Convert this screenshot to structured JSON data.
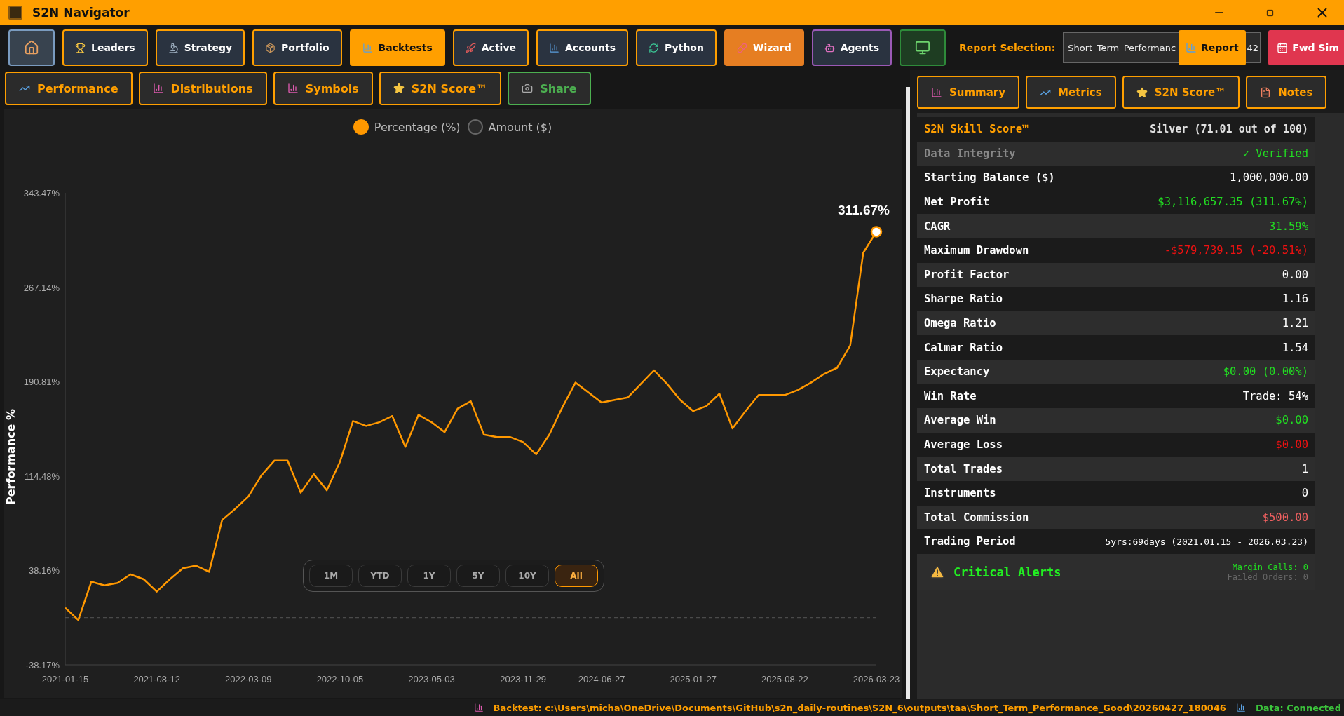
{
  "window": {
    "title": "S2N Navigator"
  },
  "nav": [
    {
      "kind": "icon",
      "selected": false,
      "color": "#7a9bbf"
    },
    {
      "kind": "outline",
      "label": "Leaders",
      "selected": false,
      "color": "#ff9f00"
    },
    {
      "kind": "outline",
      "label": "Strategy",
      "selected": false,
      "color": "#ff9f00"
    },
    {
      "kind": "outline",
      "label": "Portfolio",
      "selected": false,
      "color": "#ff9f00"
    },
    {
      "kind": "outline",
      "label": "Backtests",
      "selected": true,
      "color": "#ff9f00"
    },
    {
      "kind": "outline",
      "label": "Active",
      "selected": false,
      "color": "#ff9f00"
    },
    {
      "kind": "outline",
      "label": "Accounts",
      "selected": false,
      "color": "#ff9f00"
    },
    {
      "kind": "outline",
      "label": "Python",
      "selected": false,
      "color": "#ff9f00"
    },
    {
      "kind": "filled",
      "label": "Wizard",
      "selected": false,
      "color": "#e67e22"
    },
    {
      "kind": "outline",
      "label": "Agents",
      "selected": false,
      "color": "#9b59b6"
    },
    {
      "kind": "icon",
      "selected": false,
      "color": "#2e8b3a"
    }
  ],
  "report": {
    "label": "Report Selection:",
    "value": "Short_Term_Performanc",
    "value_tail": "42",
    "report_button": "Report",
    "fwd_sim_button": "Fwd Sim"
  },
  "chart_tabs": [
    {
      "label": "Performance",
      "color": "#ff9f00"
    },
    {
      "label": "Distributions",
      "color": "#ff9f00"
    },
    {
      "label": "Symbols",
      "color": "#ff9f00"
    },
    {
      "label": "S2N Score™",
      "color": "#ff9f00"
    },
    {
      "label": "Share",
      "color": "#4caf50"
    }
  ],
  "mode_options": [
    {
      "label": "Percentage (%)",
      "selected": true
    },
    {
      "label": "Amount ($)",
      "selected": false
    }
  ],
  "chart_data": {
    "type": "line",
    "ylabel": "Performance %",
    "categories": [
      "2021-01-15",
      null,
      null,
      null,
      null,
      null,
      null,
      "2021-08-12",
      null,
      null,
      null,
      null,
      null,
      null,
      "2022-03-09",
      null,
      null,
      null,
      null,
      null,
      null,
      "2022-10-05",
      null,
      null,
      null,
      null,
      null,
      null,
      "2023-05-03",
      null,
      null,
      null,
      null,
      null,
      null,
      "2023-11-29",
      null,
      null,
      null,
      null,
      null,
      "2024-06-27",
      null,
      null,
      null,
      null,
      null,
      null,
      "2025-01-27",
      null,
      null,
      null,
      null,
      null,
      null,
      "2025-08-22",
      null,
      null,
      null,
      null,
      null,
      null,
      "2026-03-23"
    ],
    "series": [
      {
        "color": "#ff9800",
        "values": [
          8,
          -2,
          29,
          26,
          28,
          35,
          31,
          21,
          31,
          40,
          42,
          37,
          79,
          88,
          98,
          115,
          127,
          127,
          101,
          116,
          103,
          126,
          159,
          155,
          158,
          163,
          138,
          164,
          158,
          150,
          169,
          175,
          148,
          146,
          146,
          142,
          132,
          148,
          170,
          190,
          182,
          174,
          176,
          178,
          189,
          200,
          189,
          176,
          167,
          171,
          181,
          153,
          167,
          180,
          180,
          180,
          184,
          190,
          197,
          202,
          220,
          295,
          312
        ]
      }
    ],
    "ylim": [
      -38.17,
      343.47
    ],
    "yticks": [
      {
        "value": 343.47,
        "label": "343.47%"
      },
      {
        "value": 267.14,
        "label": "267.14%"
      },
      {
        "value": 190.81,
        "label": "190.81%"
      },
      {
        "value": 114.48,
        "label": "114.48%"
      },
      {
        "value": 38.16,
        "label": "38.16%"
      },
      {
        "value": -38.17,
        "label": "-38.17%"
      }
    ],
    "ref_lines": [
      {
        "axis": "y",
        "value": 0
      }
    ],
    "annotations": [
      "311.67%"
    ]
  },
  "ranges": [
    {
      "label": "1M",
      "selected": false
    },
    {
      "label": "YTD",
      "selected": false
    },
    {
      "label": "1Y",
      "selected": false
    },
    {
      "label": "5Y",
      "selected": false
    },
    {
      "label": "10Y",
      "selected": false
    },
    {
      "label": "All",
      "selected": true
    }
  ],
  "summary_tabs": [
    {
      "label": "Summary"
    },
    {
      "label": "Metrics"
    },
    {
      "label": "S2N Score™"
    },
    {
      "label": "Notes"
    }
  ],
  "metrics": [
    {
      "kind": "score",
      "label": "S2N Skill Score™",
      "value": "Silver (71.01 out of 100)",
      "color": "#e0e0e0",
      "shaded": false
    },
    {
      "kind": "integrity",
      "label": "Data Integrity",
      "value": "✓ Verified",
      "color": "#22dd22",
      "shaded": true
    },
    {
      "kind": "metric",
      "label": "Starting Balance ($)",
      "value": "1,000,000.00",
      "color": "#ffffff",
      "shaded": false
    },
    {
      "kind": "metric",
      "label": "Net Profit",
      "value": "$3,116,657.35 (311.67%)",
      "color": "#22dd22",
      "shaded": false
    },
    {
      "kind": "metric",
      "label": "CAGR",
      "value": "31.59%",
      "color": "#22dd22",
      "shaded": true
    },
    {
      "kind": "metric",
      "label": "Maximum Drawdown",
      "value": "-$579,739.15 (-20.51%)",
      "color": "#ee1111",
      "shaded": false
    },
    {
      "kind": "metric",
      "label": "Profit Factor",
      "value": "0.00",
      "color": "#ffffff",
      "shaded": true
    },
    {
      "kind": "metric",
      "label": "Sharpe Ratio",
      "value": "1.16",
      "color": "#ffffff",
      "shaded": false
    },
    {
      "kind": "metric",
      "label": "Omega Ratio",
      "value": "1.21",
      "color": "#ffffff",
      "shaded": true
    },
    {
      "kind": "metric",
      "label": "Calmar Ratio",
      "value": "1.54",
      "color": "#ffffff",
      "shaded": false
    },
    {
      "kind": "metric",
      "label": "Expectancy",
      "value": "$0.00 (0.00%)",
      "color": "#22dd22",
      "shaded": true
    },
    {
      "kind": "metric",
      "label": "Win Rate",
      "value": "Trade: 54%",
      "color": "#ffffff",
      "shaded": false
    },
    {
      "kind": "metric",
      "label": "Average Win",
      "value": "$0.00",
      "color": "#22dd22",
      "shaded": true
    },
    {
      "kind": "metric",
      "label": "Average Loss",
      "value": "$0.00",
      "color": "#ee1111",
      "shaded": false
    },
    {
      "kind": "metric",
      "label": "Total Trades",
      "value": "1",
      "color": "#ffffff",
      "shaded": true
    },
    {
      "kind": "metric",
      "label": "Instruments",
      "value": "0",
      "color": "#ffffff",
      "shaded": false
    },
    {
      "kind": "metric",
      "label": "Total Commission",
      "value": "$500.00",
      "color": "#f06060",
      "shaded": true
    },
    {
      "kind": "period",
      "label": "Trading Period",
      "value": "5yrs:69days (2021.01.15 - 2026.03.23)",
      "color": "#ffffff",
      "shaded": false
    }
  ],
  "alerts": {
    "title": "Critical Alerts",
    "margin_calls": "Margin Calls: 0",
    "failed_orders": "Failed Orders: 0"
  },
  "status_bar": {
    "backtest": "Backtest: c:\\Users\\micha\\OneDrive\\Documents\\GitHub\\s2n_daily-routines\\S2N_6\\outputs\\taa\\Short_Term_Performance_Good\\20260427_180046",
    "data": "Data: Connected"
  }
}
